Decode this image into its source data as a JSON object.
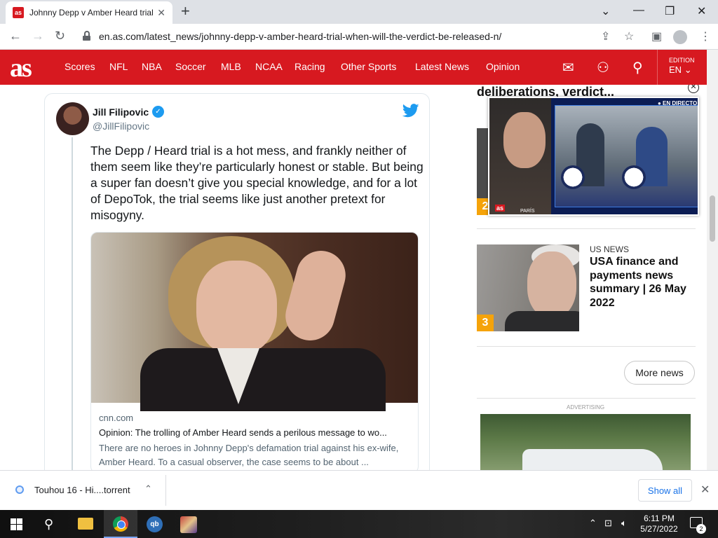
{
  "browser": {
    "tab_title": "Johnny Depp v Amber Heard trial",
    "tab_favicon": "as",
    "url": "en.as.com/latest_news/johnny-depp-v-amber-heard-trial-when-will-the-verdict-be-released-n/"
  },
  "site": {
    "logo": "as",
    "nav": [
      "Scores",
      "NFL",
      "NBA",
      "Soccer",
      "MLB",
      "NCAA",
      "Racing",
      "Other Sports",
      "Latest News",
      "Opinion"
    ],
    "edition_label": "EDITION",
    "edition_value": "EN",
    "brand_color": "#d71920"
  },
  "tweet": {
    "name": "Jill Filipovic",
    "handle": "@JillFilipovic",
    "text": "The Depp / Heard trial is a hot mess, and frankly neither of them seem like they’re particularly honest or stable. But being a super fan doesn’t give you special knowledge, and for a lot of DepoTok, the trial seems like just another pretext for misogyny.",
    "card": {
      "source": "cnn.com",
      "title": "Opinion: The trolling of Amber Heard sends a perilous message to wo...",
      "description": "There are no heroes in Johnny Depp's defamation trial against his ex-wife, Amber Heard. To a casual observer, the case seems to be about ..."
    }
  },
  "sidebar": {
    "partial_headline": "deliberations, verdict...",
    "item2_number": "2",
    "item3": {
      "number": "3",
      "kicker": "US NEWS",
      "headline": "USA finance and payments news summary | 26 May 2022"
    },
    "more_news": "More news",
    "ad_label": "ADVERTISING"
  },
  "video": {
    "live_label": "● EN DIRECTO",
    "location": "PARÍS",
    "brand": "as"
  },
  "downloads": {
    "file_name": "Touhou 16 - Hi....torrent",
    "show_all": "Show all"
  },
  "taskbar": {
    "time": "6:11 PM",
    "date": "5/27/2022",
    "notification_count": "2",
    "qb_label": "qb"
  }
}
